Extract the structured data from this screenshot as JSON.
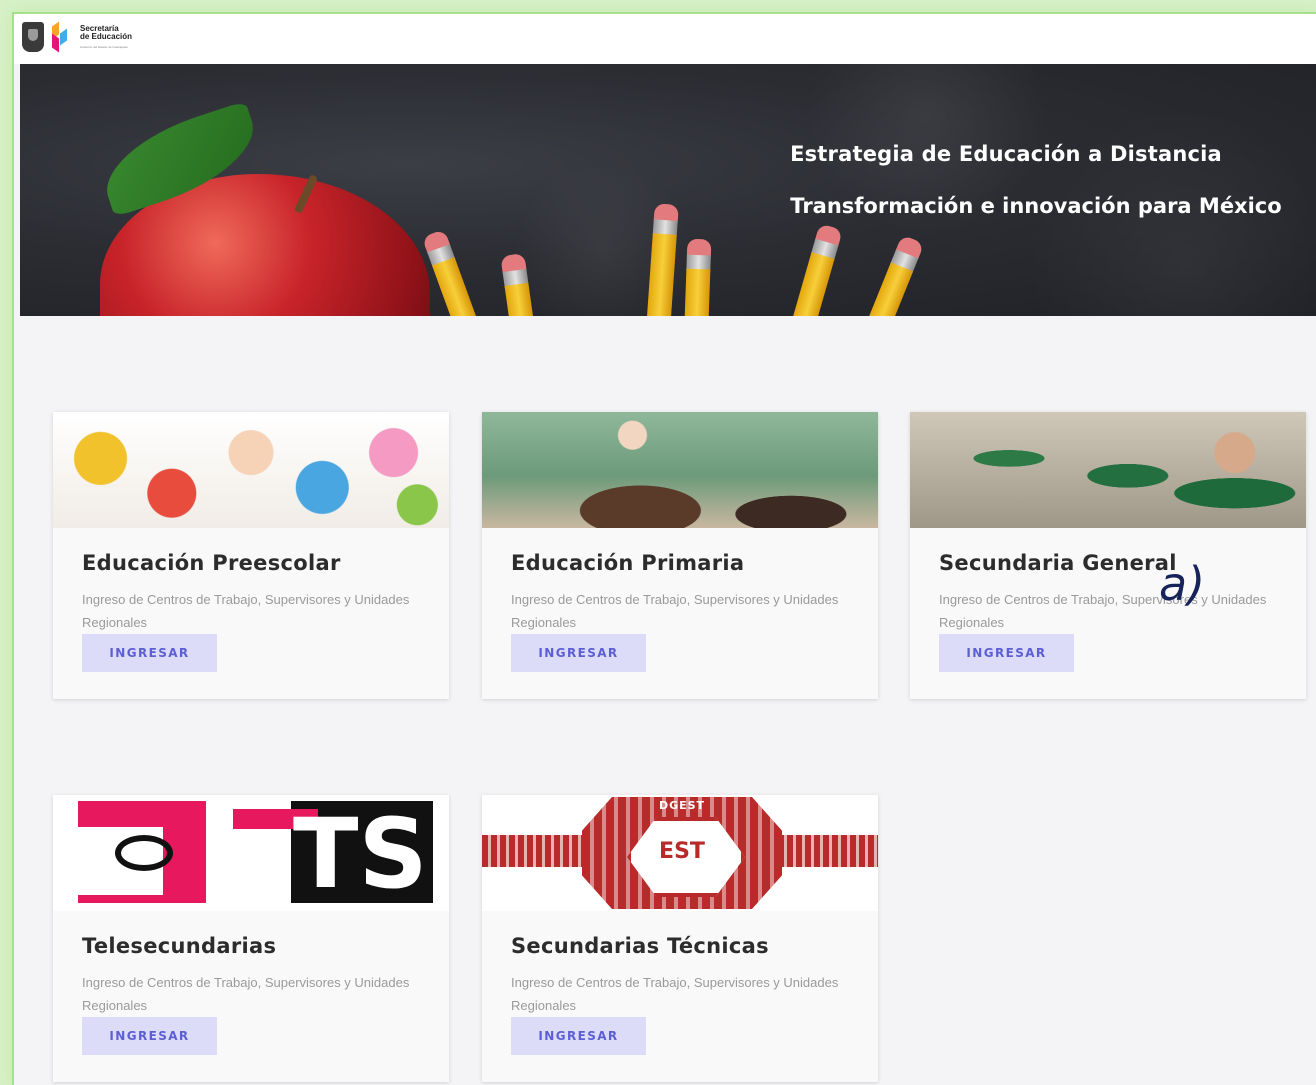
{
  "header": {
    "brand_line1": "Secretaría",
    "brand_line2": "de Educación",
    "brand_sub": "Gobierno del Estado de Guanajuato"
  },
  "hero": {
    "title": "Estrategia de Educación a Distancia",
    "subtitle": "Transformación e innovación para México"
  },
  "cards": [
    {
      "title": "Educación Preescolar",
      "description": "Ingreso de Centros de Trabajo, Supervisores y Unidades Regionales",
      "button": "INGRESAR"
    },
    {
      "title": "Educación Primaria",
      "description": "Ingreso de Centros de Trabajo, Supervisores y Unidades Regionales",
      "button": "INGRESAR"
    },
    {
      "title": "Secundaria General",
      "description": "Ingreso de Centros de Trabajo, Supervisores y Unidades Regionales",
      "button": "INGRESAR"
    },
    {
      "title": "Telesecundarias",
      "description": "Ingreso de Centros de Trabajo, Supervisores y Unidades Regionales",
      "button": "INGRESAR"
    },
    {
      "title": "Secundarias Técnicas",
      "description": "Ingreso de Centros de Trabajo, Supervisores y Unidades Regionales",
      "button": "INGRESAR"
    }
  ],
  "logos": {
    "telesecundaria": "TS",
    "tecnicas_top": "DGEST",
    "tecnicas_center": "EST"
  },
  "annotation": "a)",
  "colors": {
    "button_bg": "#dcdcf8",
    "button_text": "#5c5fd4",
    "frame_highlight": "#a6e08f",
    "hero_bg": "#2b2d33"
  }
}
